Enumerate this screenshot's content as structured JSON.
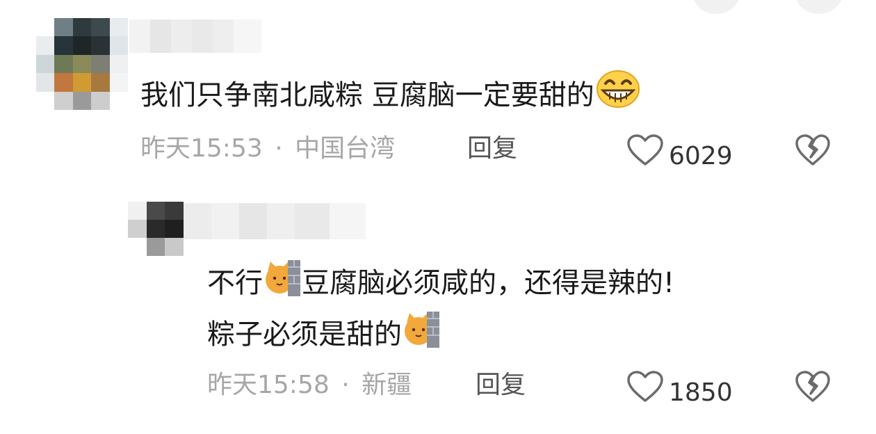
{
  "comments": [
    {
      "text_before": "我们只争南北咸粽 豆腐脑一定要甜的",
      "emoji": "grinning-face",
      "time": "昨天15:53",
      "separator": "·",
      "location": "中国台湾",
      "reply_label": "回复",
      "likes": "6029"
    },
    {
      "line1_before": "不行",
      "line1_after": "豆腐脑必须咸的，还得是辣的!",
      "line2_before": "粽子必须是甜的",
      "emoji": "cat-behind-wall",
      "time": "昨天15:58",
      "separator": "·",
      "location": "新疆",
      "reply_label": "回复",
      "likes": "1850"
    }
  ],
  "colors": {
    "text": "#1a1a1a",
    "meta": "#a6a6a6",
    "reply": "#555555",
    "icon": "#6b6b6b"
  }
}
